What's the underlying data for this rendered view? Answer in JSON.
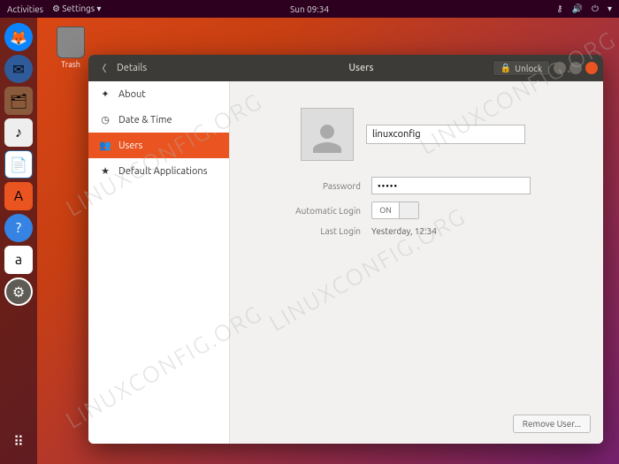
{
  "topbar": {
    "activities": "Activities",
    "settings": "Settings ▾",
    "clock": "Sun 09:34"
  },
  "desktop": {
    "trash_label": "Trash"
  },
  "window": {
    "back_section": "Details",
    "title": "Users",
    "unlock": "Unlock"
  },
  "sidebar": {
    "items": [
      {
        "icon": "✦",
        "label": "About"
      },
      {
        "icon": "◷",
        "label": "Date & Time"
      },
      {
        "icon": "👥",
        "label": "Users"
      },
      {
        "icon": "★",
        "label": "Default Applications"
      }
    ]
  },
  "user": {
    "name": "linuxconfig",
    "password_label": "Password",
    "password_value": "•••••",
    "autologin_label": "Automatic Login",
    "autologin_state": "ON",
    "lastlogin_label": "Last Login",
    "lastlogin_value": "Yesterday, 12:34",
    "remove": "Remove User..."
  },
  "watermark": "LINUXCONFIG.ORG"
}
